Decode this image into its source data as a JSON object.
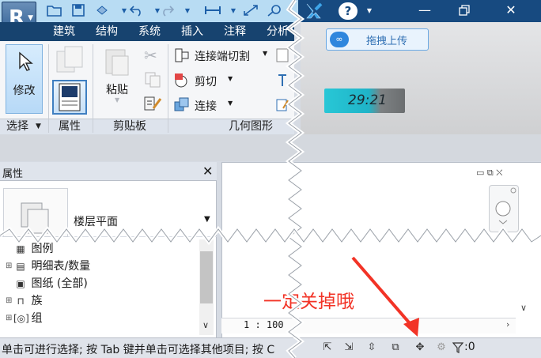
{
  "app": {
    "logo_letter": "R"
  },
  "ribbon": {
    "tabs": [
      "建筑",
      "结构",
      "系统",
      "插入",
      "注释",
      "分析"
    ],
    "modify_label": "修改",
    "paste_label": "粘贴",
    "rows": [
      "连接端切割",
      "剪切",
      "连接"
    ],
    "panels": [
      "选择",
      "属性",
      "剪贴板",
      "几何图形"
    ]
  },
  "overlay": {
    "upload_label": "拖拽上传",
    "timer": "29:21"
  },
  "properties": {
    "title": "属性",
    "type_label": "楼层平面"
  },
  "browser": {
    "items": [
      "图例",
      "明细表/数量",
      "图纸 (全部)",
      "族",
      "组"
    ]
  },
  "canvas": {
    "scale": "1 : 100"
  },
  "status": {
    "text": "单击可进行选择; 按 Tab 键并单击可选择其他项目; 按 C",
    "filter_count": ":0"
  },
  "annotation": {
    "text": "一定关掉哦"
  },
  "colors": {
    "tab_bar": "#17436f",
    "title_bar_right": "#174a80",
    "annotation_red": "#f23326",
    "accent_blue": "#2f86dd"
  },
  "icons": [
    "cursor-arrow-icon",
    "open-folder-icon",
    "save-icon",
    "undo-icon",
    "redo-icon",
    "help-icon",
    "minimize-icon",
    "restore-icon",
    "close-icon",
    "scissors-icon",
    "copy-icon",
    "upload-cloud-icon",
    "filter-icon",
    "gear-icon"
  ]
}
